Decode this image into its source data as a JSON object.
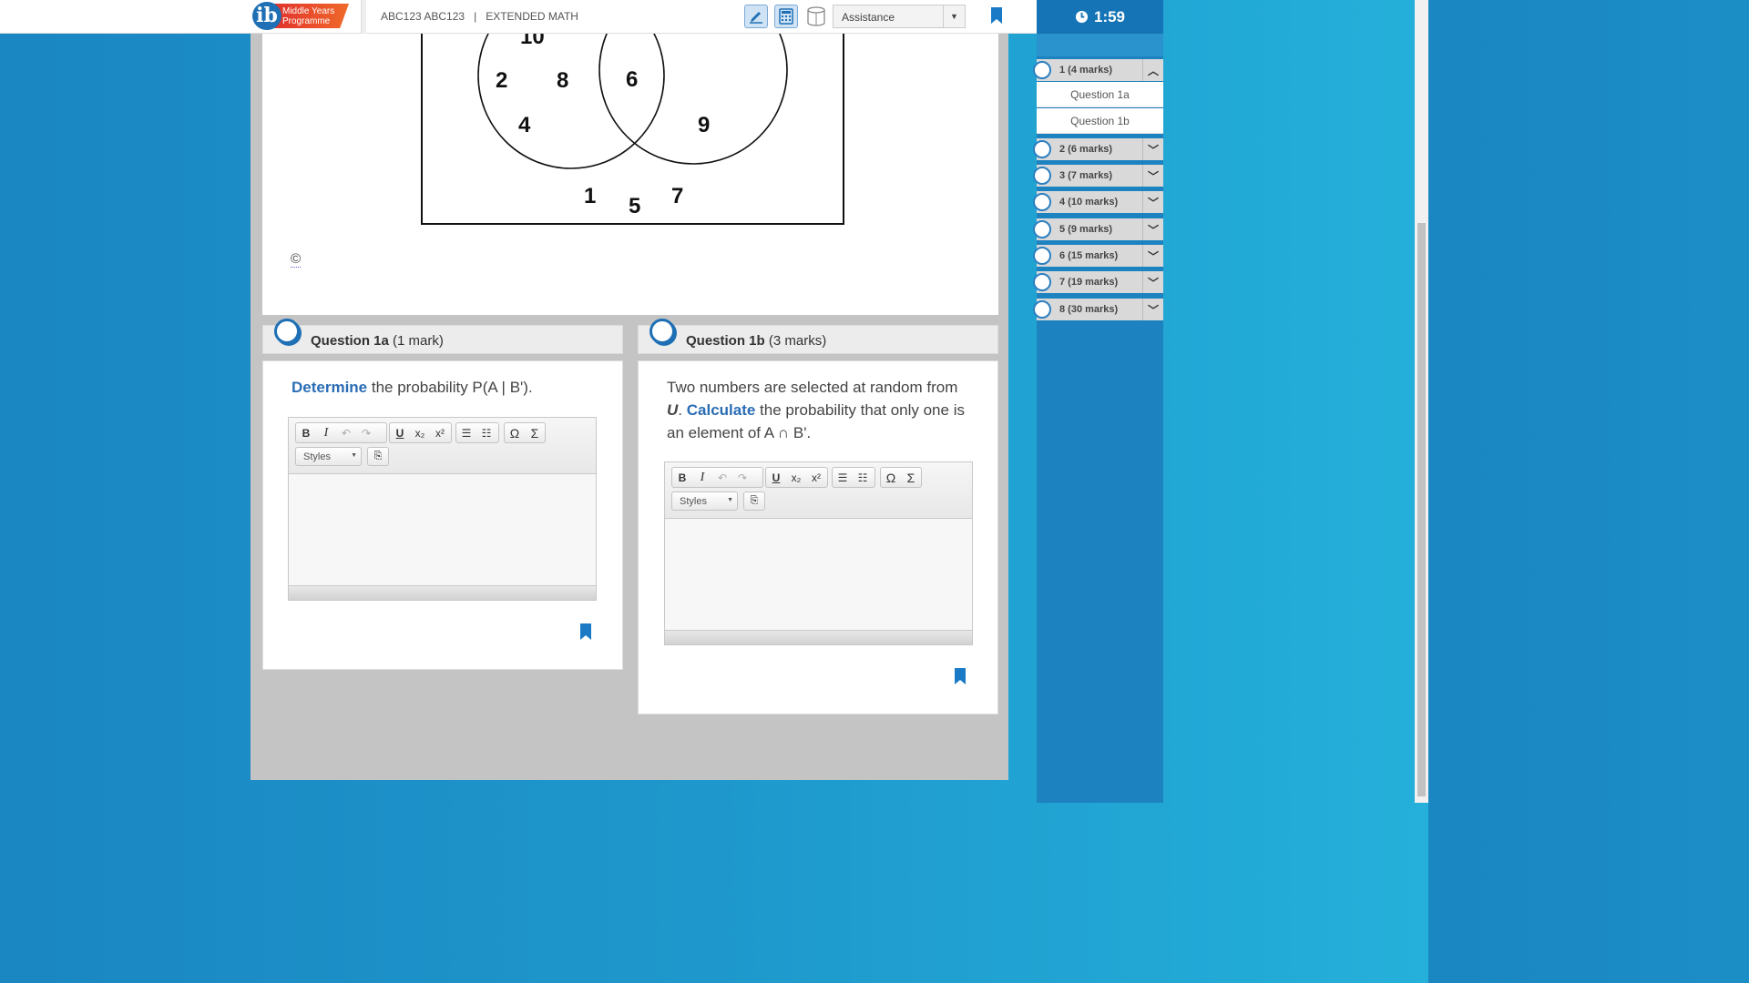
{
  "header": {
    "logo_text": "Middle Years Programme",
    "candidate": "ABC123 ABC123",
    "separator": "|",
    "subject": "EXTENDED MATH",
    "assistance_label": "Assistance"
  },
  "timer": {
    "value": "1:59"
  },
  "sidebar": {
    "questions": [
      {
        "label": "1 (4 marks)",
        "expanded": true,
        "subs": [
          "Question 1a",
          "Question 1b"
        ]
      },
      {
        "label": "2 (6 marks)",
        "expanded": false
      },
      {
        "label": "3 (7 marks)",
        "expanded": false
      },
      {
        "label": "4 (10 marks)",
        "expanded": false
      },
      {
        "label": "5 (9 marks)",
        "expanded": false
      },
      {
        "label": "6 (15 marks)",
        "expanded": false
      },
      {
        "label": "7 (19 marks)",
        "expanded": false
      },
      {
        "label": "8 (30 marks)",
        "expanded": false
      }
    ]
  },
  "stem": {
    "venn": {
      "set_a_only": [
        "10",
        "2",
        "8",
        "4"
      ],
      "intersection": [
        "6"
      ],
      "set_b_only": [
        "9"
      ],
      "outside": [
        "1",
        "5",
        "7"
      ]
    },
    "copyright": "©"
  },
  "q1a": {
    "title": "Question 1a",
    "marks": "(1 mark)",
    "command": "Determine",
    "text": " the probability P(A | B')."
  },
  "q1b": {
    "title": "Question 1b",
    "marks": "(3 marks)",
    "text_pre": "Two numbers are selected at random from ",
    "set_name": "U",
    "text_mid": ". ",
    "command": "Calculate",
    "text_post": " the probability that only one is an element of A ∩ B'."
  },
  "editor": {
    "styles_label": "Styles",
    "buttons": {
      "bold": "B",
      "italic": "I",
      "underline": "U",
      "omega": "Ω",
      "sigma": "Σ"
    }
  }
}
